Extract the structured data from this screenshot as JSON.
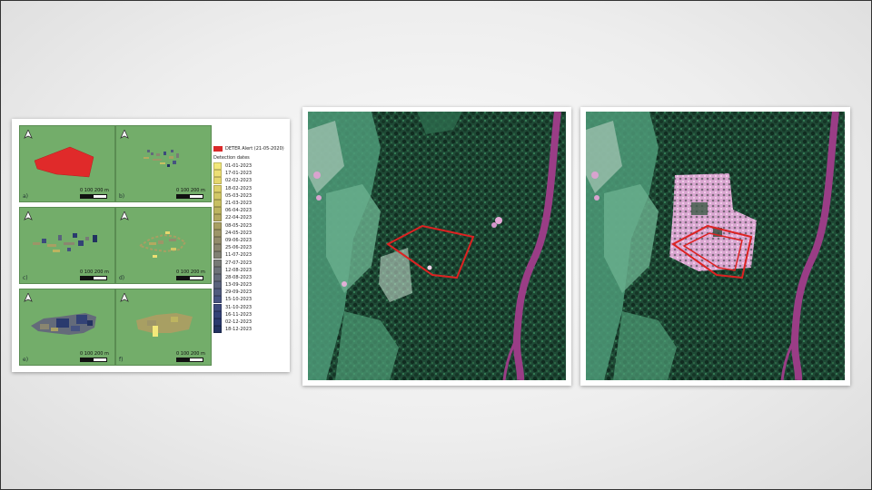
{
  "figure": {
    "panels": [
      {
        "label": "a)",
        "scale": "0  100 200 m"
      },
      {
        "label": "b)",
        "scale": "0  100 200 m"
      },
      {
        "label": "c)",
        "scale": "0  100 200 m"
      },
      {
        "label": "d)",
        "scale": "0  100 200 m"
      },
      {
        "label": "e)",
        "scale": "0  100 200 m"
      },
      {
        "label": "f)",
        "scale": "0  100 200 m"
      }
    ],
    "legend": {
      "alert_label": "DETER Alert (21-05-2020)",
      "alert_color": "#d92a2a",
      "title": "Detection dates",
      "dates": [
        {
          "label": "01-01-2023",
          "color": "#f2e87a"
        },
        {
          "label": "17-01-2023",
          "color": "#eddf74"
        },
        {
          "label": "02-02-2023",
          "color": "#e5d76e"
        },
        {
          "label": "18-02-2023",
          "color": "#dcd06a"
        },
        {
          "label": "05-03-2023",
          "color": "#d2c866"
        },
        {
          "label": "21-03-2023",
          "color": "#c8bf62"
        },
        {
          "label": "06-04-2023",
          "color": "#bdb460"
        },
        {
          "label": "22-04-2023",
          "color": "#b3a960"
        },
        {
          "label": "08-05-2023",
          "color": "#a89f63"
        },
        {
          "label": "24-05-2023",
          "color": "#9d9568"
        },
        {
          "label": "09-06-2023",
          "color": "#938c6c"
        },
        {
          "label": "25-06-2023",
          "color": "#8a8670"
        },
        {
          "label": "11-07-2023",
          "color": "#808073"
        },
        {
          "label": "27-07-2023",
          "color": "#777a76"
        },
        {
          "label": "12-08-2023",
          "color": "#6d7278"
        },
        {
          "label": "28-08-2023",
          "color": "#646b7a"
        },
        {
          "label": "13-09-2023",
          "color": "#5a637c"
        },
        {
          "label": "29-09-2023",
          "color": "#505b7e"
        },
        {
          "label": "15-10-2023",
          "color": "#465380"
        },
        {
          "label": "31-10-2023",
          "color": "#3c4a7c"
        },
        {
          "label": "16-11-2023",
          "color": "#334276"
        },
        {
          "label": "02-12-2023",
          "color": "#2a3a6e"
        },
        {
          "label": "18-12-2023",
          "color": "#223260"
        }
      ]
    }
  },
  "colors": {
    "panel_green": "#73ad6a",
    "alert_red": "#d92a2a",
    "river": "#9a3d86",
    "polygon_outline": "#d22"
  }
}
